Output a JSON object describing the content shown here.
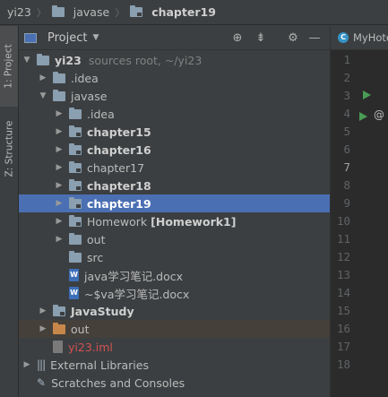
{
  "breadcrumb": {
    "items": [
      {
        "label": "yi23",
        "icon": "none"
      },
      {
        "label": "javase",
        "icon": "folder-icon"
      },
      {
        "label": "chapter19",
        "icon": "module-folder-icon"
      }
    ]
  },
  "side_stripe": {
    "project_tab": "1: Project",
    "structure_tab": "Z: Structure"
  },
  "project_panel": {
    "title": "Project",
    "toolbar_icons": [
      "locate-icon",
      "collapse-icon",
      "gear-icon",
      "minimize-icon"
    ]
  },
  "tree": [
    {
      "label": "yi23",
      "hint": "sources root,  ~/yi23",
      "indent": 0,
      "arrow": "down",
      "icon": "folder",
      "style": "bold"
    },
    {
      "label": ".idea",
      "indent": 1,
      "arrow": "right",
      "icon": "folder",
      "style": "normal"
    },
    {
      "label": "javase",
      "indent": 1,
      "arrow": "down",
      "icon": "folder",
      "style": "normal"
    },
    {
      "label": ".idea",
      "indent": 2,
      "arrow": "right",
      "icon": "folder",
      "style": "normal"
    },
    {
      "label": "chapter15",
      "indent": 2,
      "arrow": "right",
      "icon": "module",
      "style": "bold"
    },
    {
      "label": "chapter16",
      "indent": 2,
      "arrow": "right",
      "icon": "module",
      "style": "bold"
    },
    {
      "label": "chapter17",
      "indent": 2,
      "arrow": "right",
      "icon": "module",
      "style": "normal"
    },
    {
      "label": "chapter18",
      "indent": 2,
      "arrow": "right",
      "icon": "module",
      "style": "bold"
    },
    {
      "label": "chapter19",
      "indent": 2,
      "arrow": "right",
      "icon": "module",
      "style": "bold-white",
      "selected": true
    },
    {
      "label": "Homework",
      "tag": "[Homework1]",
      "indent": 2,
      "arrow": "right",
      "icon": "module",
      "style": "normal"
    },
    {
      "label": "out",
      "indent": 2,
      "arrow": "right",
      "icon": "folder",
      "style": "normal"
    },
    {
      "label": "src",
      "indent": 2,
      "arrow": "none",
      "icon": "folder",
      "style": "normal"
    },
    {
      "label": "java学习笔记.docx",
      "indent": 2,
      "arrow": "none",
      "icon": "docx",
      "style": "normal"
    },
    {
      "label": "~$va学习笔记.docx",
      "indent": 2,
      "arrow": "none",
      "icon": "docx",
      "style": "normal"
    },
    {
      "label": "JavaStudy",
      "indent": 1,
      "arrow": "right",
      "icon": "module",
      "style": "bold"
    },
    {
      "label": "out",
      "indent": 1,
      "arrow": "right",
      "icon": "folder-orange",
      "style": "normal",
      "brown": true
    },
    {
      "label": "yi23.iml",
      "indent": 1,
      "arrow": "none",
      "icon": "iml",
      "style": "red"
    },
    {
      "label": "External Libraries",
      "indent": 0,
      "arrow": "right",
      "icon": "libs",
      "style": "normal"
    },
    {
      "label": "Scratches and Consoles",
      "indent": 0,
      "arrow": "none",
      "icon": "scratch",
      "style": "normal"
    }
  ],
  "editor": {
    "tab_label": "MyHotel",
    "line_numbers": [
      "1",
      "2",
      "3",
      "4",
      "5",
      "6",
      "7",
      "8",
      "9",
      "10",
      "11",
      "12",
      "13",
      "14",
      "15",
      "16",
      "17",
      "18"
    ],
    "current_line": "7",
    "annotation_glyph": "@"
  },
  "colors": {
    "background": "#3c3f41",
    "selection": "#4a6fb3",
    "editor_bg": "#2b2b2b",
    "excluded_row": "#45403a",
    "run_green": "#499c54",
    "iml_red": "#d25252"
  }
}
